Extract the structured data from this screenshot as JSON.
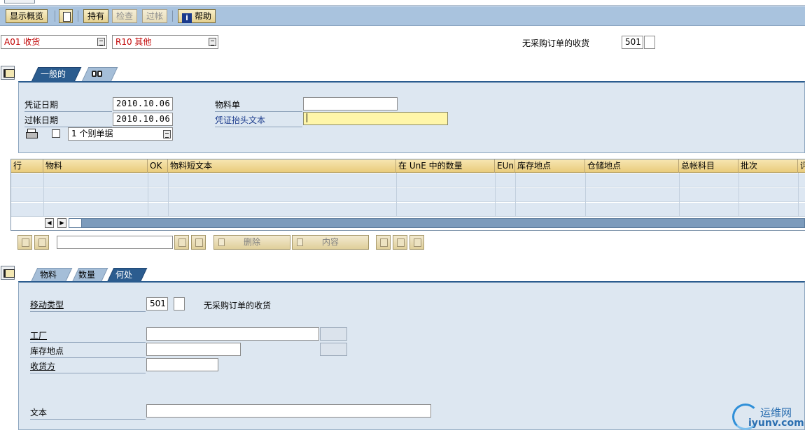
{
  "toolbar": {
    "show_overview": "显示概览",
    "hold": "持有",
    "check": "检查",
    "post": "过帐",
    "help": "帮助"
  },
  "header": {
    "transaction": "A01 收货",
    "reference": "R10 其他",
    "movement_desc": "无采购订单的收货",
    "movement_code": "501"
  },
  "tabs_top": {
    "general": "一般的",
    "second_icon": "glasses-icon"
  },
  "general": {
    "doc_date_label": "凭证日期",
    "doc_date": "2010.10.06",
    "posting_date_label": "过帐日期",
    "posting_date": "2010.10.06",
    "material_slip_label": "物料单",
    "material_slip": "",
    "header_text_label": "凭证抬头文本",
    "header_text": "",
    "print_option": "1 个别单据"
  },
  "grid": {
    "columns": [
      "行",
      "物料",
      "OK",
      "物料短文本",
      "在 UnE 中的数量",
      "EUn",
      "库存地点",
      "仓储地点",
      "总帐科目",
      "批次",
      "评"
    ],
    "rows": [
      [],
      [],
      []
    ]
  },
  "grid_toolbar": {
    "delete": "删除",
    "content": "内容",
    "search_value": ""
  },
  "tabs_bottom": {
    "material": "物料",
    "quantity": "数量",
    "where": "何处"
  },
  "detail": {
    "movement_type_label": "移动类型",
    "movement_type": "501",
    "movement_type_desc": "无采购订单的收货",
    "plant_label": "工厂",
    "plant": "",
    "storage_location_label": "库存地点",
    "storage_location": "",
    "receiver_label": "收货方",
    "receiver": "",
    "text_label": "文本",
    "text": ""
  },
  "watermark": {
    "line1": "运维网",
    "line2": "iyunv.com"
  },
  "colors": {
    "toolbar_bg": "#a9c3de",
    "panel_bg": "#dde7f1",
    "active_tab": "#2b5c8f",
    "grid_header": "#e9cc7c",
    "required_field": "#fff6a9",
    "dropdown_text": "#c00000"
  }
}
